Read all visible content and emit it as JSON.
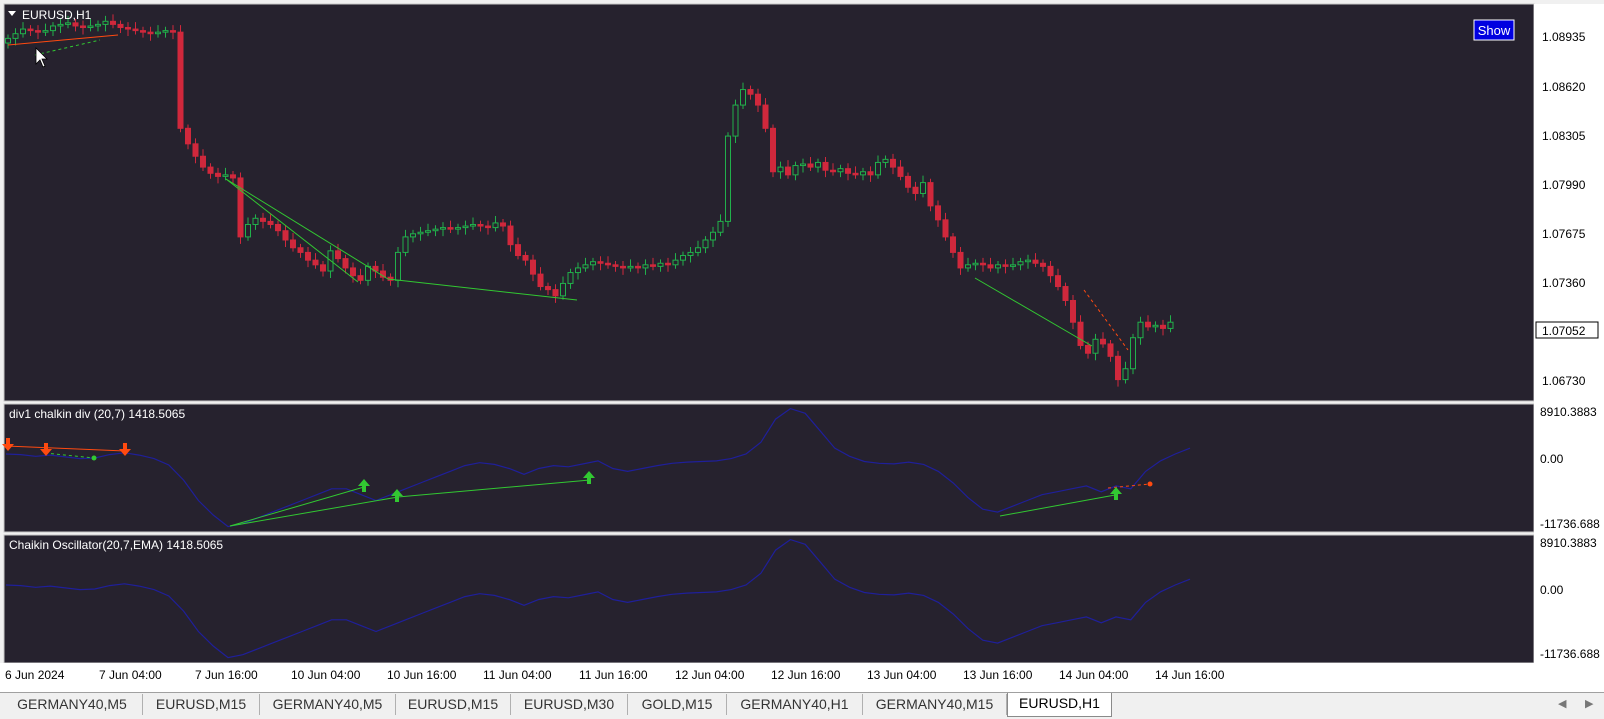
{
  "symbol_title": "EURUSD,H1",
  "show_button": "Show",
  "price_axis": {
    "labels": [
      "1.08935",
      "1.08620",
      "1.08305",
      "1.07990",
      "1.07675",
      "1.07360",
      "1.06730"
    ],
    "current_price": "1.07052"
  },
  "indicator1": {
    "title": "div1 chalkin div (20,7) 1418.5065",
    "axis_top": "8910.3883",
    "axis_mid": "0.00",
    "axis_bot": "-11736.688"
  },
  "indicator2": {
    "title": "Chaikin Oscillator(20,7,EMA) 1418.5065",
    "axis_top": "8910.3883",
    "axis_mid": "0.00",
    "axis_bot": "-11736.688"
  },
  "time_axis": [
    "6 Jun 2024",
    "7 Jun 04:00",
    "7 Jun 16:00",
    "10 Jun 04:00",
    "10 Jun 16:00",
    "11 Jun 04:00",
    "11 Jun 16:00",
    "12 Jun 04:00",
    "12 Jun 16:00",
    "13 Jun 04:00",
    "13 Jun 16:00",
    "14 Jun 04:00",
    "14 Jun 16:00"
  ],
  "tabs": [
    "GERMANY40,M5",
    "EURUSD,M15",
    "GERMANY40,M5",
    "EURUSD,M15",
    "EURUSD,M30",
    "GOLD,M15",
    "GERMANY40,H1",
    "GERMANY40,M15",
    "EURUSD,H1"
  ],
  "active_tab": "EURUSD,H1",
  "colors": {
    "background": "#26222e",
    "grid_border": "#c8c8c8",
    "bull": "#21b04b",
    "bear": "#d0283c",
    "indicator_line": "#1f1f9a",
    "div_bull": "#32c832",
    "div_bear": "#ff4a10",
    "price_label_bg": "#ffffff",
    "show_button_bg": "#0000e0"
  },
  "chart_data": {
    "type": "candlestick",
    "symbol": "EURUSD",
    "timeframe": "H1",
    "close_series": [
      1.0888,
      1.0891,
      1.0894,
      1.0893,
      1.0892,
      1.0893,
      1.0896,
      1.0897,
      1.0898,
      1.0896,
      1.0895,
      1.0896,
      1.0897,
      1.0899,
      1.0897,
      1.0895,
      1.0894,
      1.0893,
      1.0892,
      1.0891,
      1.0892,
      1.0893,
      1.0892,
      1.083,
      1.082,
      1.0812,
      1.0805,
      1.0801,
      1.0799,
      1.08,
      1.0798,
      1.076,
      1.0768,
      1.0772,
      1.077,
      1.0768,
      1.0764,
      1.0758,
      1.0753,
      1.075,
      1.0745,
      1.0742,
      1.0738,
      1.0751,
      1.0746,
      1.074,
      1.0735,
      1.0732,
      1.0741,
      1.0738,
      1.0734,
      1.0732,
      1.075,
      1.076,
      1.0762,
      1.0763,
      1.0764,
      1.0765,
      1.0766,
      1.0765,
      1.0766,
      1.0767,
      1.0768,
      1.0767,
      1.0766,
      1.0769,
      1.0767,
      1.0755,
      1.0748,
      1.0745,
      1.0736,
      1.0728,
      1.0726,
      1.0722,
      1.073,
      1.0737,
      1.074,
      1.0742,
      1.0744,
      1.0743,
      1.0742,
      1.0741,
      1.074,
      1.0741,
      1.074,
      1.0742,
      1.0741,
      1.0743,
      1.0742,
      1.0745,
      1.0748,
      1.075,
      1.0753,
      1.0758,
      1.0763,
      1.077,
      1.0825,
      1.0845,
      1.0855,
      1.0852,
      1.0845,
      1.083,
      1.0802,
      1.0805,
      1.08,
      1.0806,
      1.0807,
      1.0805,
      1.0808,
      1.0803,
      1.0802,
      1.0804,
      1.0801,
      1.08,
      1.0802,
      1.08,
      1.0808,
      1.081,
      1.0805,
      1.0799,
      1.0792,
      1.0788,
      1.0795,
      1.078,
      1.0771,
      1.076,
      1.075,
      1.074,
      1.0742,
      1.0743,
      1.0742,
      1.074,
      1.0742,
      1.0741,
      1.0742,
      1.0744,
      1.0745,
      1.0743,
      1.0741,
      1.0735,
      1.0728,
      1.0719,
      1.0705,
      1.069,
      1.0685,
      1.0694,
      1.0691,
      1.0683,
      1.0668,
      1.0675,
      1.0695,
      1.0705,
      1.0702,
      1.0703,
      1.0701,
      1.0705
    ],
    "oscillator_series": [
      1000,
      900,
      600,
      800,
      500,
      200,
      300,
      900,
      1200,
      800,
      200,
      -900,
      -3500,
      -7000,
      -9500,
      -11500,
      -11000,
      -10000,
      -9000,
      -8000,
      -7000,
      -6000,
      -5000,
      -5000,
      -6000,
      -7000,
      -6000,
      -5000,
      -4000,
      -3000,
      -2000,
      -1000,
      -500,
      -800,
      -1500,
      -2500,
      -1500,
      -1000,
      -1200,
      -700,
      -200,
      -1500,
      -2000,
      -1500,
      -1000,
      -600,
      -400,
      -300,
      -200,
      200,
      1000,
      3000,
      7000,
      8800,
      8000,
      5000,
      2000,
      600,
      -300,
      -600,
      -700,
      -400,
      -800,
      -2000,
      -4000,
      -6500,
      -8500,
      -9000,
      -8000,
      -7000,
      -6000,
      -5500,
      -5000,
      -4500,
      -5500,
      -4500,
      -5000,
      -2000,
      -200,
      1000,
      2000
    ]
  }
}
